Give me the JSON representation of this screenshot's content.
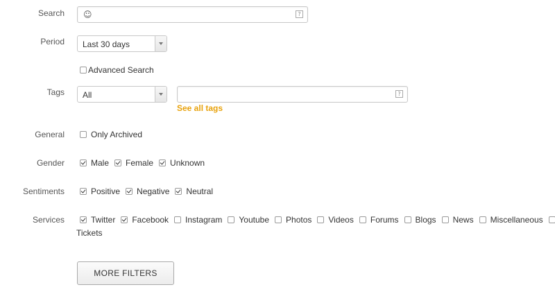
{
  "search": {
    "label": "Search",
    "value": "☺",
    "help": "?"
  },
  "period": {
    "label": "Period",
    "selected": "Last 30 days"
  },
  "advanced_search": {
    "label": "Advanced Search",
    "checked": false
  },
  "tags": {
    "label": "Tags",
    "selected": "All",
    "input_value": "",
    "help": "?",
    "see_all": "See all tags"
  },
  "general": {
    "label": "General",
    "options": [
      {
        "label": "Only Archived",
        "checked": false
      }
    ]
  },
  "gender": {
    "label": "Gender",
    "options": [
      {
        "label": "Male",
        "checked": true
      },
      {
        "label": "Female",
        "checked": true
      },
      {
        "label": "Unknown",
        "checked": true
      }
    ]
  },
  "sentiments": {
    "label": "Sentiments",
    "options": [
      {
        "label": "Positive",
        "checked": true
      },
      {
        "label": "Negative",
        "checked": true
      },
      {
        "label": "Neutral",
        "checked": true
      }
    ]
  },
  "services": {
    "label": "Services",
    "options": [
      {
        "label": "Twitter",
        "checked": true
      },
      {
        "label": "Facebook",
        "checked": true
      },
      {
        "label": "Instagram",
        "checked": false
      },
      {
        "label": "Youtube",
        "checked": false
      },
      {
        "label": "Photos",
        "checked": false
      },
      {
        "label": "Videos",
        "checked": false
      },
      {
        "label": "Forums",
        "checked": false
      },
      {
        "label": "Blogs",
        "checked": false
      },
      {
        "label": "News",
        "checked": false
      },
      {
        "label": "Miscellaneous",
        "checked": false
      },
      {
        "label": "Tickets",
        "checked": false
      }
    ]
  },
  "more_filters": {
    "label": "MORE FILTERS"
  }
}
